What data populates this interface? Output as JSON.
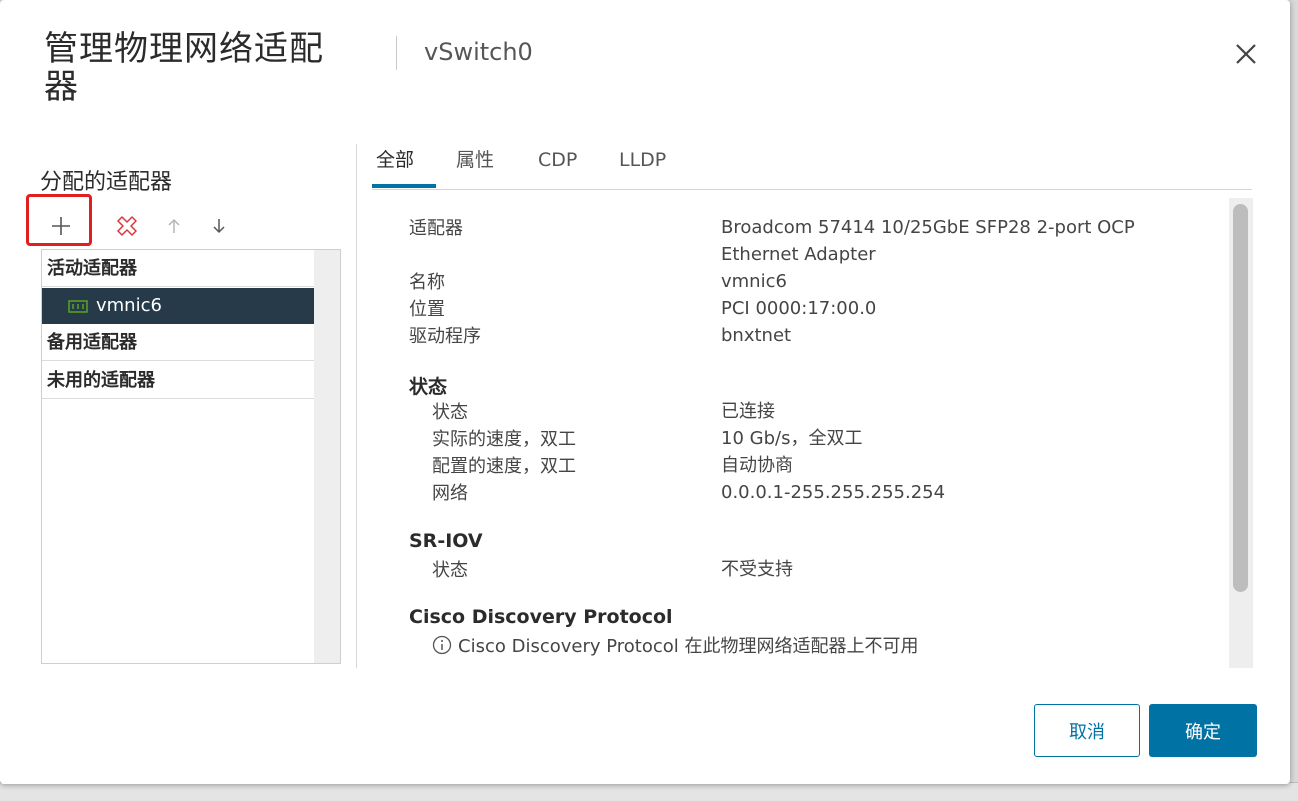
{
  "dialog": {
    "title": "管理物理网络适配器",
    "subtitle": "vSwitch0"
  },
  "left_panel": {
    "section_title": "分配的适配器",
    "groups": {
      "active": "活动适配器",
      "standby": "备用适配器",
      "unused": "未用的适配器"
    },
    "adapters": [
      {
        "name": "vmnic6",
        "group": "active",
        "selected": true
      }
    ],
    "toolbar_icons": [
      "add-icon",
      "remove-icon",
      "arrow-up-icon",
      "arrow-down-icon"
    ]
  },
  "tabs": [
    {
      "label": "全部",
      "active": true
    },
    {
      "label": "属性",
      "active": false
    },
    {
      "label": "CDP",
      "active": false
    },
    {
      "label": "LLDP",
      "active": false
    }
  ],
  "details": {
    "adapter_label": "适配器",
    "adapter_value": "Broadcom 57414 10/25GbE SFP28 2-port OCP Ethernet Adapter",
    "name_label": "名称",
    "name_value": "vmnic6",
    "location_label": "位置",
    "location_value": "PCI 0000:17:00.0",
    "driver_label": "驱动程序",
    "driver_value": "bnxtnet",
    "status_section": "状态",
    "status_label": "状态",
    "status_value": "已连接",
    "actual_speed_label": "实际的速度，双工",
    "actual_speed_value": "10 Gb/s，全双工",
    "configured_speed_label": "配置的速度，双工",
    "configured_speed_value": "自动协商",
    "network_label": "网络",
    "network_value": "0.0.0.1-255.255.255.254",
    "sriov_section": "SR-IOV",
    "sriov_status_label": "状态",
    "sriov_status_value": "不受支持",
    "cdp_section": "Cisco Discovery Protocol",
    "cdp_message": "Cisco Discovery Protocol 在此物理网络适配器上不可用"
  },
  "footer": {
    "cancel": "取消",
    "ok": "确定"
  },
  "colors": {
    "primary": "#0072a3",
    "selected_row": "#263a4a",
    "highlight": "#e02020",
    "remove_icon": "#d9363e",
    "nic_icon": "#5aa220"
  }
}
